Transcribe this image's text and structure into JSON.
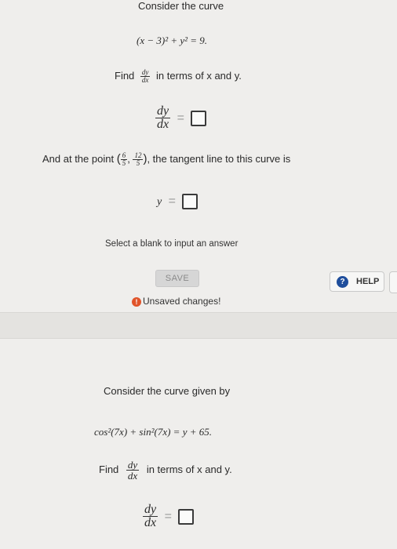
{
  "q1": {
    "intro": "Consider the curve",
    "equation": "(x − 3)² + y² = 9.",
    "find_prefix": "Find",
    "deriv_num": "dy",
    "deriv_den": "dx",
    "find_suffix": "in terms of x and y.",
    "point_prefix": "And at the point",
    "point_x_num": "6",
    "point_x_den": "5",
    "point_y_num": "12",
    "point_y_den": "5",
    "point_suffix": ", the tangent line to this curve is",
    "y_label": "y",
    "equals": "=",
    "select_hint": "Select a blank to input an answer"
  },
  "actions": {
    "save_label": "SAVE",
    "unsaved_text": "Unsaved changes!",
    "help_label": "HELP"
  },
  "q2": {
    "intro": "Consider the curve given by",
    "equation": "cos²(7x) + sin²(7x) = y + 65.",
    "find_prefix": "Find",
    "deriv_num": "dy",
    "deriv_den": "dx",
    "find_suffix": "in terms of x and y.",
    "equals": "="
  }
}
